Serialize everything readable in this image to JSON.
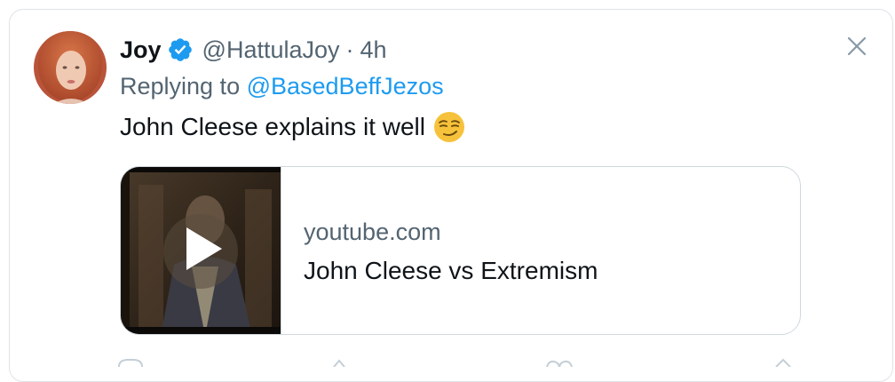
{
  "tweet": {
    "author_name": "Joy",
    "author_handle": "@HattulaJoy",
    "separator": "·",
    "time": "4h",
    "replying_prefix": "Replying to ",
    "replying_to": "@BasedBeffJezos",
    "text": "John Cleese explains it well",
    "emoji": "smirking-face"
  },
  "link_card": {
    "domain": "youtube.com",
    "title": "John Cleese vs Extremism"
  },
  "colors": {
    "accent": "#1d9bf0",
    "text_primary": "#0f1419",
    "text_secondary": "#536471",
    "border": "#cfd9de"
  },
  "icons": {
    "verified": "verified-badge-icon",
    "close": "close-icon",
    "play": "play-icon"
  }
}
